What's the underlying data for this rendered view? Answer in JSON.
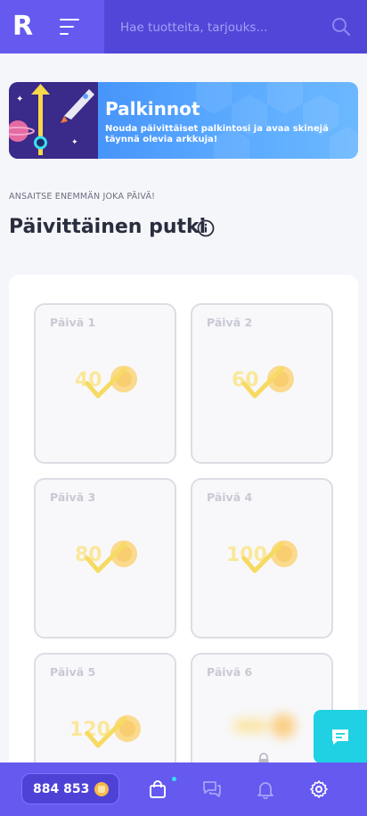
{
  "header": {
    "logo": "R",
    "search_placeholder": "Hae tuotteita, tarjouks..."
  },
  "banner": {
    "title": "Palkinnot",
    "subtitle": "Nouda päivittäiset palkintosi ja avaa skinejä täynnä olevia arkkuja!"
  },
  "section": {
    "eyebrow": "ANSAITSE ENEMMÄN JOKA PÄIVÄ!",
    "title": "Päivittäinen putki"
  },
  "days": [
    {
      "label": "Päivä 1",
      "amount": "40",
      "claimed": true
    },
    {
      "label": "Päivä 2",
      "amount": "60",
      "claimed": true
    },
    {
      "label": "Päivä 3",
      "amount": "80",
      "claimed": true
    },
    {
      "label": "Päivä 4",
      "amount": "100",
      "claimed": true
    },
    {
      "label": "Päivä 5",
      "amount": "120",
      "claimed": true
    },
    {
      "label": "Päivä 6",
      "amount": "",
      "claimed": false
    }
  ],
  "bottom_nav": {
    "balance": "884 853",
    "icons": [
      "shopping-bag-icon",
      "chat-bubbles-icon",
      "bell-icon",
      "gear-icon"
    ]
  },
  "colors": {
    "primary": "#6559f0",
    "search_bg": "#5246d9",
    "chat_fab": "#1fd1e3",
    "banner": "#56a6ff"
  }
}
